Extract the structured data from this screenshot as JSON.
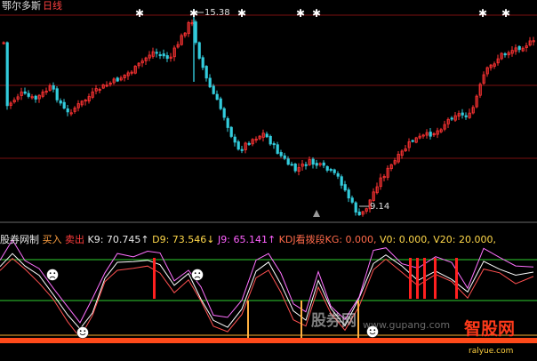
{
  "window": {
    "stock_name": "鄂尔多斯",
    "period": "日线"
  },
  "price_chart": {
    "high_label": "15.38",
    "low_label": "9.14",
    "up_color": "#ff3333",
    "down_color": "#33ccdd",
    "grid_color": "#7a1010"
  },
  "indicator": {
    "name": "股券网制",
    "buy": "买入",
    "sell": "卖出",
    "k9": "K9: 70.745",
    "d9": "D9: 73.546",
    "j9": "J9: 65.141",
    "kdj": "KDJ看拨段KG: 0.000,",
    "v0": "V0: 0.000,",
    "v20": "V20: 20.000,"
  },
  "watermark": {
    "text1": "股券网",
    "text2": "www.gupang.com",
    "logo": "智股网",
    "url": "ralyue.com"
  },
  "chart_data": {
    "type": "candlestick",
    "y_range": [
      9.14,
      15.38
    ]
  }
}
